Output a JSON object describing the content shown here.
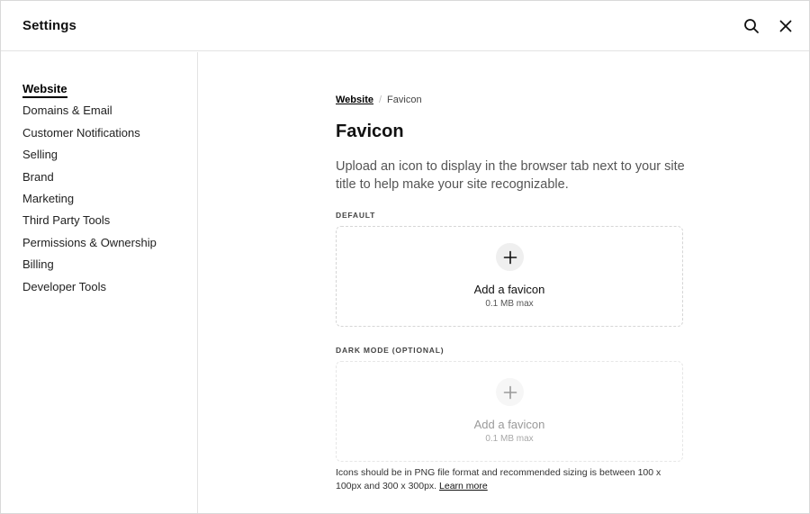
{
  "header": {
    "title": "Settings",
    "search_icon": "search-icon",
    "close_icon": "close-icon"
  },
  "sidebar": {
    "items": [
      {
        "label": "Website",
        "active": true
      },
      {
        "label": "Domains & Email",
        "active": false
      },
      {
        "label": "Customer Notifications",
        "active": false
      },
      {
        "label": "Selling",
        "active": false
      },
      {
        "label": "Brand",
        "active": false
      },
      {
        "label": "Marketing",
        "active": false
      },
      {
        "label": "Third Party Tools",
        "active": false
      },
      {
        "label": "Permissions & Ownership",
        "active": false
      },
      {
        "label": "Billing",
        "active": false
      },
      {
        "label": "Developer Tools",
        "active": false
      }
    ]
  },
  "main": {
    "breadcrumb": {
      "parent": "Website",
      "separator": "/",
      "current": "Favicon"
    },
    "title": "Favicon",
    "description": "Upload an icon to display in the browser tab next to your site title to help make your site recognizable.",
    "default_section": {
      "label": "DEFAULT",
      "add_label": "Add a favicon",
      "size_limit": "0.1 MB max",
      "icon": "plus-icon"
    },
    "dark_section": {
      "label": "DARK MODE (OPTIONAL)",
      "add_label": "Add a favicon",
      "size_limit": "0.1 MB max",
      "icon": "plus-icon"
    },
    "help_text": "Icons should be in PNG file format and recommended sizing is between 100 x 100px and 300 x 300px.",
    "learn_more": "Learn more"
  },
  "colors": {
    "text": "#111111",
    "muted": "#555555",
    "border": "#e3e3e3",
    "dashed": "#d6d6d6",
    "circle": "#efefef"
  }
}
